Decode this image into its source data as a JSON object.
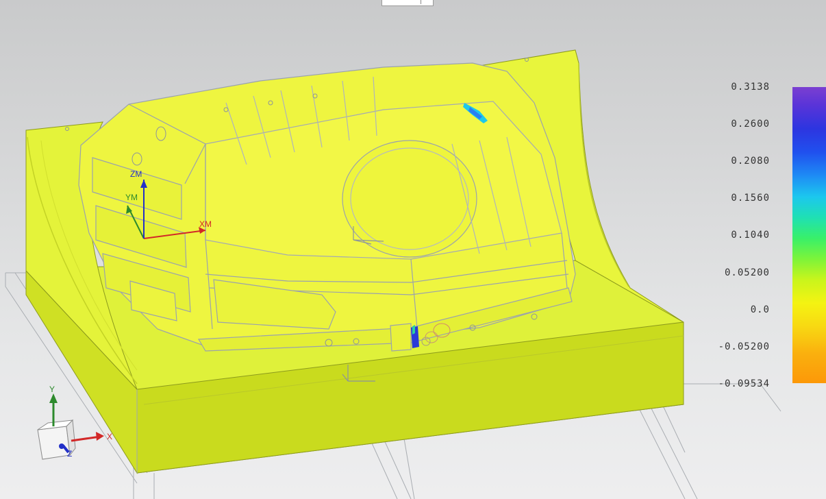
{
  "legend": {
    "values": [
      "0.3138",
      "0.2600",
      "0.2080",
      "0.1560",
      "0.1040",
      "0.05200",
      "0.0",
      "-0.05200",
      "-0.09534"
    ]
  },
  "csys_work": {
    "z": "ZM",
    "y": "YM",
    "x": "XM"
  },
  "csys_absolute": {
    "y": "Y",
    "x": "X",
    "z": "Z"
  },
  "colors": {
    "surface": "#e8f43a",
    "surface_side": "#c6d81c",
    "edge": "#9aa2ad",
    "axis_x": "#d22828",
    "axis_y": "#2d8a2d",
    "axis_z": "#2330c8"
  },
  "icons": [
    "top-tab-icon",
    "csys-cube-icon"
  ]
}
